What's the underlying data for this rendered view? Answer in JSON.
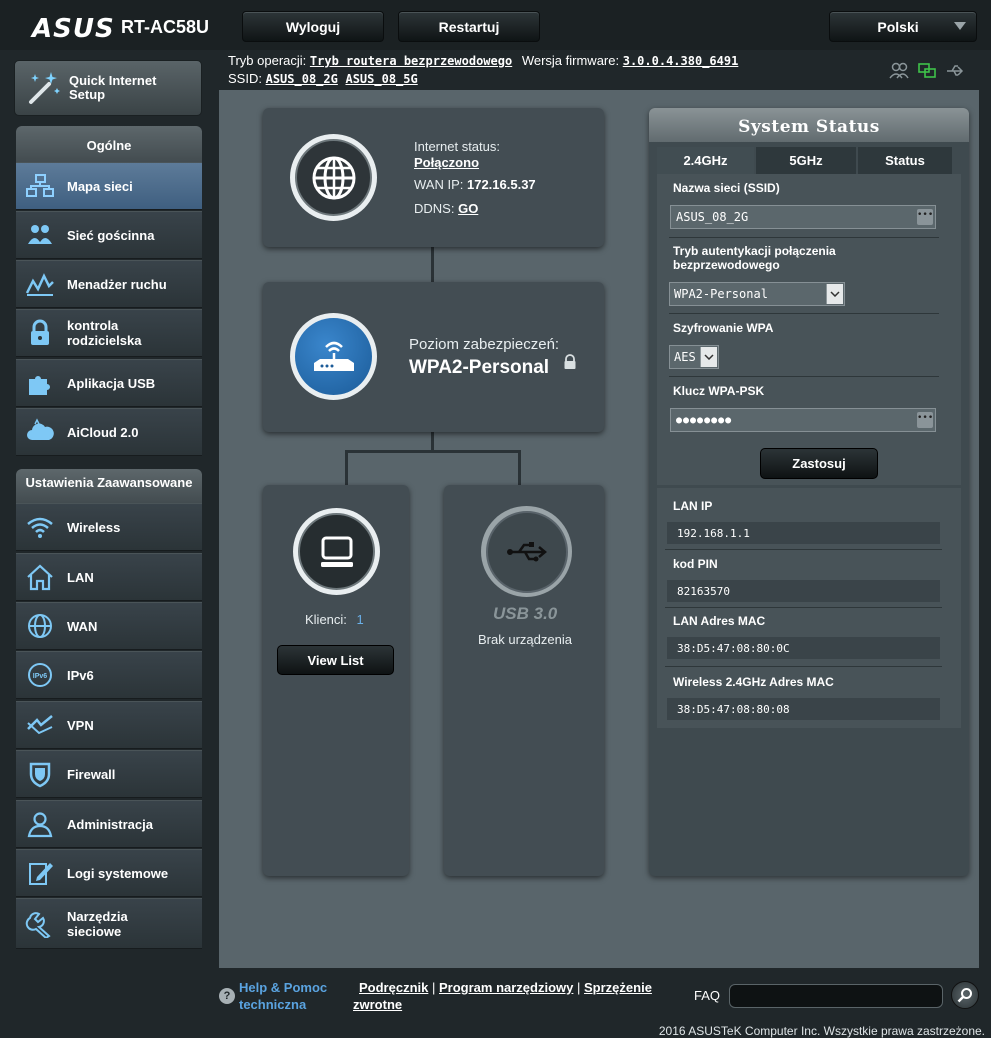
{
  "header": {
    "brand": "ASUS",
    "model": "RT-AC58U",
    "logout_label": "Wyloguj",
    "restart_label": "Restartuj",
    "language": "Polski"
  },
  "info": {
    "op_mode_label": "Tryb operacji:",
    "op_mode_value": "Tryb routera bezprzewodowego",
    "firmware_label": "Wersja firmware:",
    "firmware_value": "3.0.0.4.380_6491",
    "ssid_label": "SSID:",
    "ssid_2g": "ASUS_08_2G",
    "ssid_5g": "ASUS_08_5G"
  },
  "sidebar": {
    "quick_setup": "Quick Internet Setup",
    "general_header": "Ogólne",
    "general_items": [
      {
        "label": "Mapa sieci",
        "icon": "network-map-icon"
      },
      {
        "label": "Sieć gościnna",
        "icon": "guest-network-icon"
      },
      {
        "label": "Menadżer ruchu",
        "icon": "traffic-manager-icon"
      },
      {
        "label": "kontrola rodzicielska",
        "icon": "lock-icon"
      },
      {
        "label": "Aplikacja USB",
        "icon": "puzzle-icon"
      },
      {
        "label": "AiCloud 2.0",
        "icon": "cloud-icon"
      }
    ],
    "advanced_header": "Ustawienia Zaawansowane",
    "advanced_items": [
      {
        "label": "Wireless",
        "icon": "wifi-icon"
      },
      {
        "label": "LAN",
        "icon": "home-icon"
      },
      {
        "label": "WAN",
        "icon": "globe-icon"
      },
      {
        "label": "IPv6",
        "icon": "ipv6-icon"
      },
      {
        "label": "VPN",
        "icon": "vpn-icon"
      },
      {
        "label": "Firewall",
        "icon": "shield-icon"
      },
      {
        "label": "Administracja",
        "icon": "admin-user-icon"
      },
      {
        "label": "Logi systemowe",
        "icon": "log-icon"
      },
      {
        "label": "Narzędzia sieciowe",
        "icon": "tools-icon"
      }
    ]
  },
  "map": {
    "internet_status_label": "Internet status:",
    "internet_status_value": "Połączono",
    "wan_ip_label": "WAN IP:",
    "wan_ip_value": "172.16.5.37",
    "ddns_label": "DDNS:",
    "ddns_value": "GO",
    "security_label": "Poziom zabezpieczeń:",
    "security_value": "WPA2-Personal",
    "clients_label": "Klienci:",
    "clients_value": "1",
    "view_list": "View List",
    "usb_label": "USB 3.0",
    "usb_status": "Brak urządzenia"
  },
  "system_status": {
    "title": "System Status",
    "tabs": [
      "2.4GHz",
      "5GHz",
      "Status"
    ],
    "ssid_label": "Nazwa sieci (SSID)",
    "ssid_value": "ASUS_08_2G",
    "auth_label": "Tryb autentykacji połączenia bezprzewodowego",
    "auth_value": "WPA2-Personal",
    "enc_label": "Szyfrowanie WPA",
    "enc_value": "AES",
    "psk_label": "Klucz WPA-PSK",
    "psk_value": "●●●●●●●●",
    "apply_label": "Zastosuj",
    "lan_ip_label": "LAN IP",
    "lan_ip_value": "192.168.1.1",
    "pin_label": "kod PIN",
    "pin_value": "82163570",
    "lan_mac_label": "LAN Adres MAC",
    "lan_mac_value": "38:D5:47:08:80:0C",
    "wl_mac_label": "Wireless 2.4GHz Adres MAC",
    "wl_mac_value": "38:D5:47:08:80:08"
  },
  "footer": {
    "help_label": "Help & Pomoc techniczna",
    "manual": "Podręcznik",
    "utility": "Program narzędziowy",
    "feedback": "Sprzężenie zwrotne",
    "faq_label": "FAQ",
    "copyright": "2016 ASUSTeK Computer Inc. Wszystkie prawa zastrzeżone."
  },
  "colors": {
    "background": "#20272a",
    "main_area": "#59656b",
    "card": "#434d53",
    "active_menu": "#4f6e8e",
    "accent_blue": "#1e5f9e",
    "clients_count": "#6ab0e8"
  }
}
